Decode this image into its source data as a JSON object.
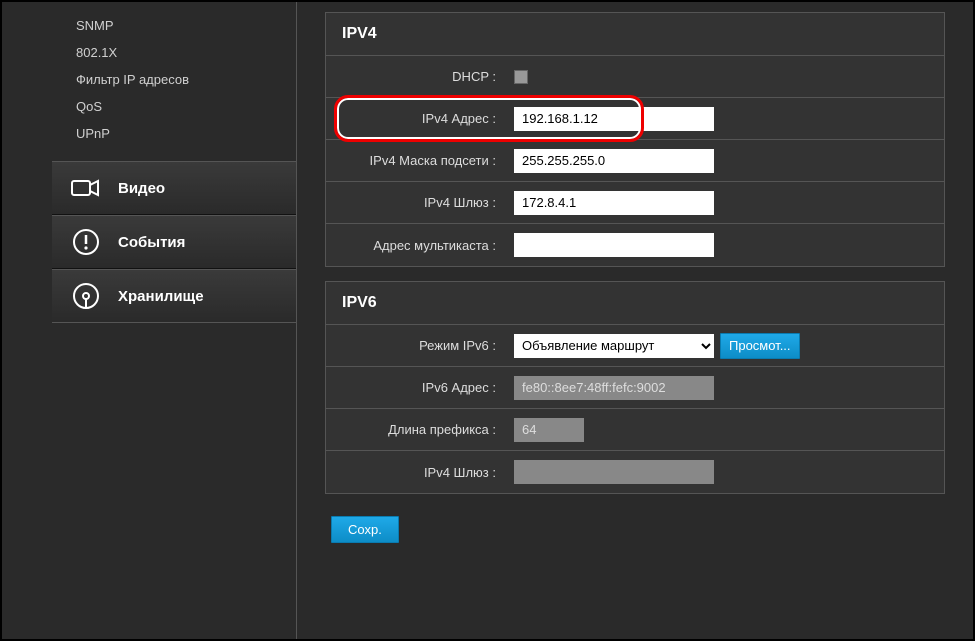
{
  "sidebar": {
    "sub_items": [
      "SNMP",
      "802.1X",
      "Фильтр IP адресов",
      "QoS",
      "UPnP"
    ],
    "main_items": [
      {
        "icon": "camera",
        "label": "Видео"
      },
      {
        "icon": "alert",
        "label": "События"
      },
      {
        "icon": "disk",
        "label": "Хранилище"
      }
    ]
  },
  "ipv4": {
    "title": "IPV4",
    "dhcp_label": "DHCP :",
    "addr_label": "IPv4 Адрес :",
    "addr_value": "192.168.1.12",
    "mask_label": "IPv4 Маска подсети :",
    "mask_value": "255.255.255.0",
    "gw_label": "IPv4 Шлюз :",
    "gw_value": "172.8.4.1",
    "mcast_label": "Адрес мультикаста :",
    "mcast_value": ""
  },
  "ipv6": {
    "title": "IPV6",
    "mode_label": "Режим IPv6 :",
    "mode_value": "Объявление маршрут",
    "view_btn": "Просмот...",
    "addr_label": "IPv6 Адрес :",
    "addr_value": "fe80::8ee7:48ff:fefc:9002",
    "prefix_label": "Длина префикса :",
    "prefix_value": "64",
    "gw_label": "IPv4 Шлюз :",
    "gw_value": ""
  },
  "save_btn": "Сохр."
}
